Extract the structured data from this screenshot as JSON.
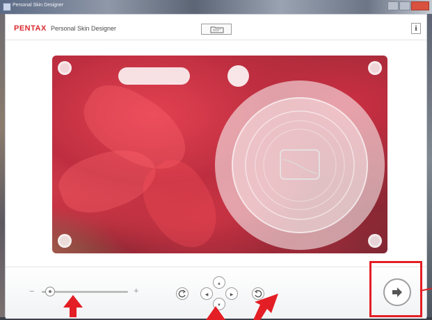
{
  "window": {
    "title": "Personal Skin Designer",
    "brand": "PENTAX",
    "app_title": "Personal Skin Designer",
    "info_label": "i"
  },
  "preview": {
    "description_icons": [
      "flash-window",
      "viewfinder",
      "lens-ring"
    ]
  },
  "toolbar": {
    "zoom_minus": "−",
    "zoom_plus": "+",
    "zoom_level": 0.1,
    "rotate_left_icon": "rotate-left-icon",
    "rotate_right_icon": "rotate-right-icon",
    "pan_up": "▲",
    "pan_down": "▼",
    "pan_left": "◀",
    "pan_right": "▶",
    "next_icon": "arrow-right-icon"
  },
  "annotations": {
    "highlight_color": "#e31e24"
  },
  "colors": {
    "brand": "#d8282e",
    "accent": "#e31e24"
  }
}
